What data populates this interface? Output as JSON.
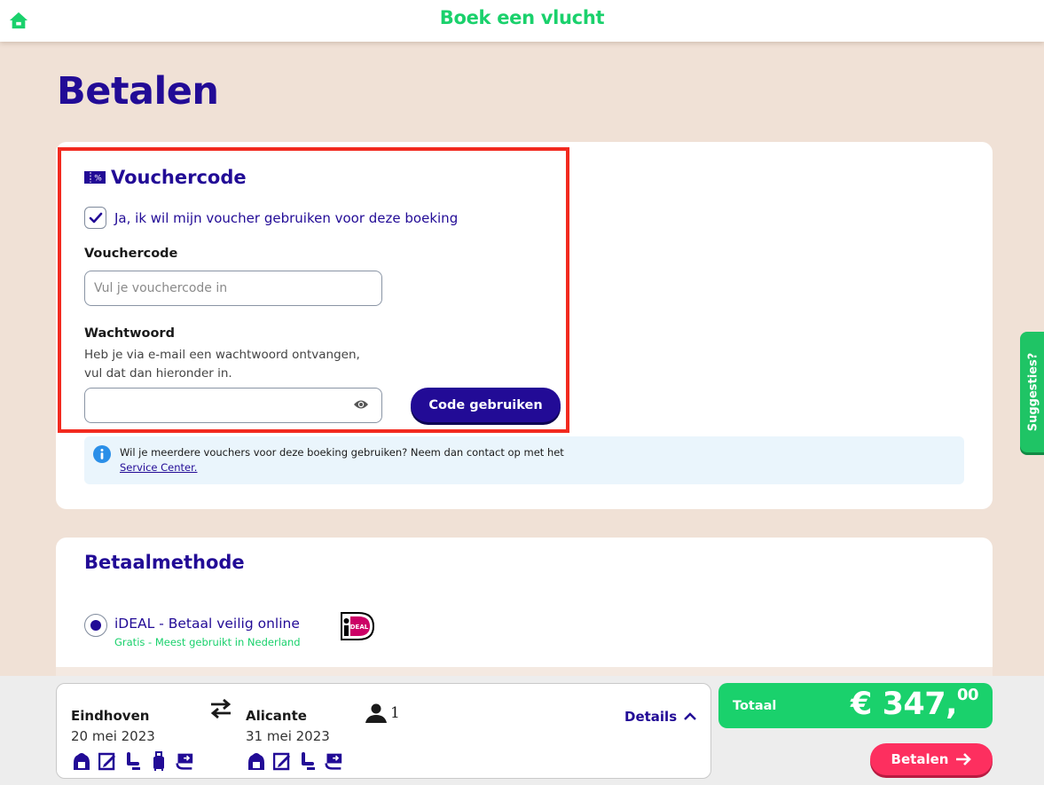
{
  "header": {
    "title": "Boek een vlucht",
    "home_icon": "home-icon"
  },
  "page": {
    "title": "Betalen"
  },
  "voucher": {
    "heading": "Vouchercode",
    "icon": "voucher-ticket-icon",
    "checkbox_label": "Ja, ik wil mijn voucher gebruiken voor deze boeking",
    "checkbox_checked": true,
    "code_label": "Vouchercode",
    "code_placeholder": "Vul je vouchercode in",
    "code_value": "",
    "password_label": "Wachtwoord",
    "password_help_line1": "Heb je via e-mail een wachtwoord ontvangen,",
    "password_help_line2": "vul dat dan hieronder in.",
    "password_value": "",
    "submit_label": "Code gebruiken",
    "info_text": "Wil je meerdere vouchers voor deze boeking gebruiken? Neem dan contact op met het",
    "info_link": "Service Center."
  },
  "payment": {
    "title": "Betaalmethode",
    "methods": [
      {
        "label": "iDEAL - Betaal veilig online",
        "sub": "Gratis - Meest gebruikt in Nederland",
        "selected": true,
        "logo_text": "iDEAL"
      }
    ]
  },
  "side_tab": {
    "label": "Suggesties?"
  },
  "summary": {
    "outbound": {
      "city": "Eindhoven",
      "date": "20 mei 2023",
      "icons": [
        "backpack-icon",
        "edit-checkin-icon",
        "seat-icon",
        "suitcase-icon",
        "flex-rebook-icon"
      ]
    },
    "return": {
      "city": "Alicante",
      "date": "31 mei 2023",
      "icons": [
        "backpack-icon",
        "edit-checkin-icon",
        "seat-icon",
        "flex-rebook-icon"
      ]
    },
    "passengers": "1",
    "details_label": "Details",
    "total_label": "Totaal",
    "total_currency": "€",
    "total_whole": "347,",
    "total_cents": "00",
    "pay_label": "Betalen"
  },
  "colors": {
    "brand_purple": "#220b96",
    "brand_green": "#1ad16c",
    "pay_pink": "#fd2f5f",
    "page_bg": "#f0e1d6",
    "highlight_red": "#f22a1f"
  }
}
